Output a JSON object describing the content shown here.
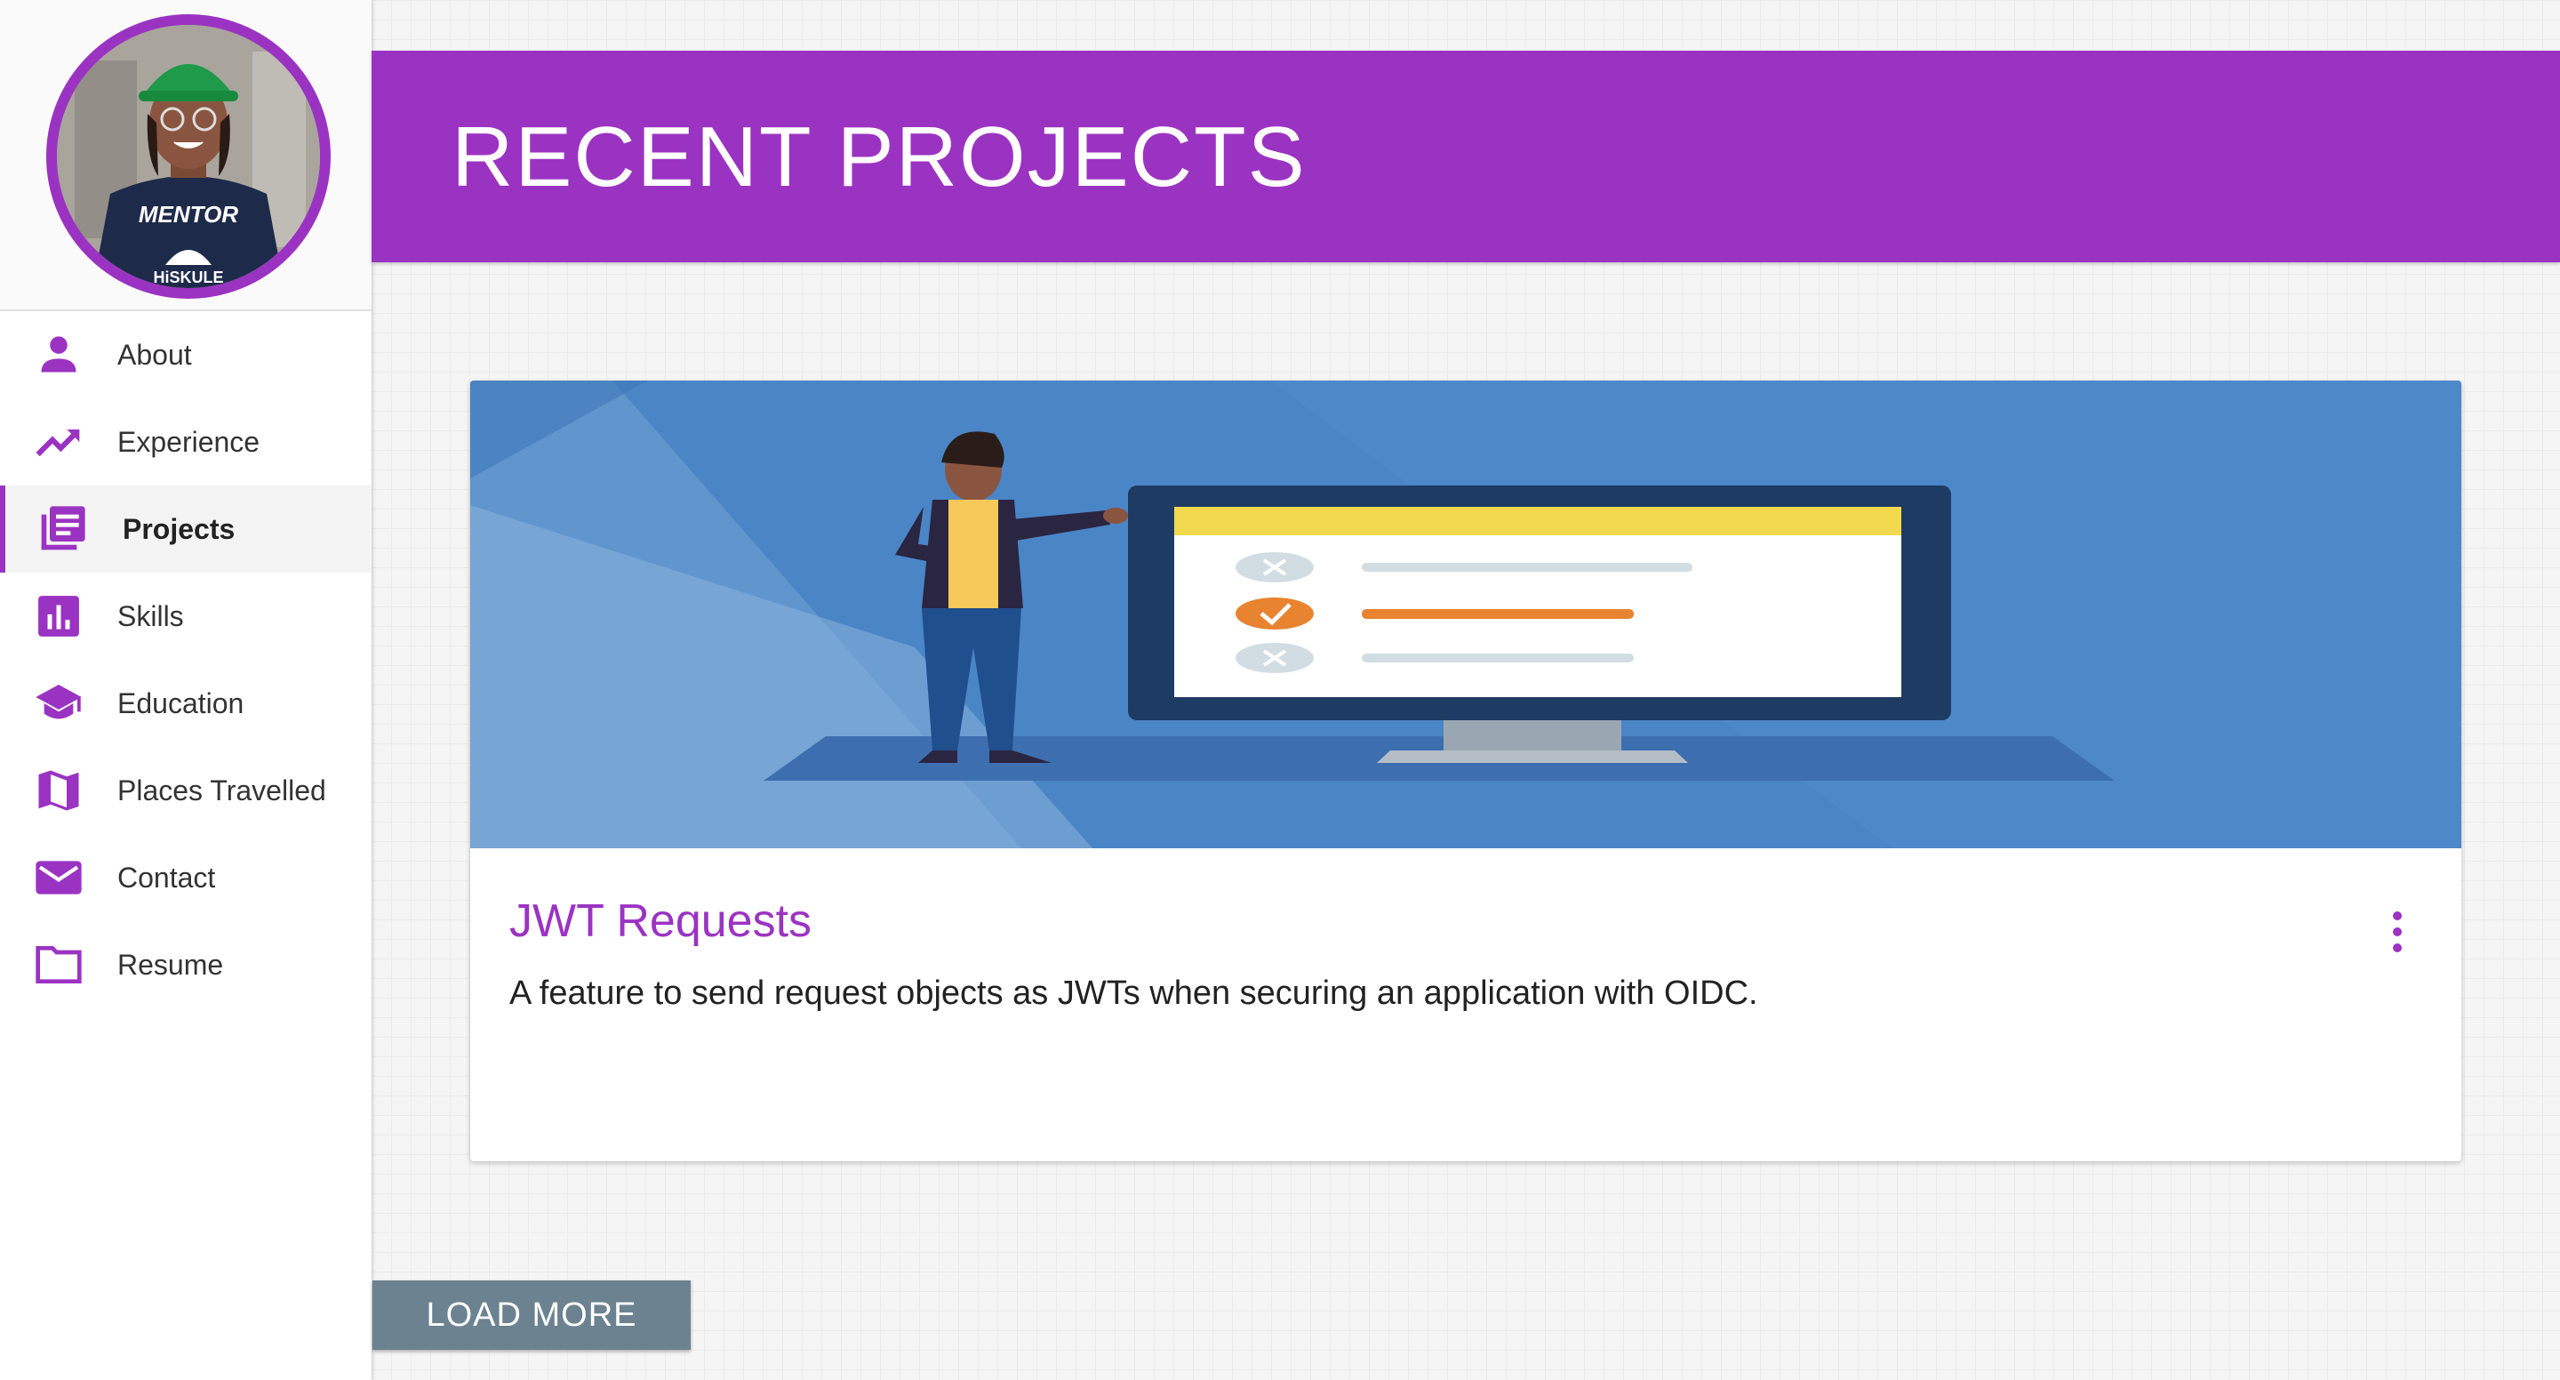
{
  "sidebar": {
    "avatar_alt": "profile-photo",
    "shirt_text": "MENTOR",
    "shirt_logo_text": "HiSKULE",
    "items": [
      {
        "label": "About",
        "icon": "person-icon",
        "active": false
      },
      {
        "label": "Experience",
        "icon": "trending-up-icon",
        "active": false
      },
      {
        "label": "Projects",
        "icon": "list-document-icon",
        "active": true
      },
      {
        "label": "Skills",
        "icon": "bar-chart-icon",
        "active": false
      },
      {
        "label": "Education",
        "icon": "graduation-cap-icon",
        "active": false
      },
      {
        "label": "Places Travelled",
        "icon": "map-icon",
        "active": false
      },
      {
        "label": "Contact",
        "icon": "mail-icon",
        "active": false
      },
      {
        "label": "Resume",
        "icon": "folder-icon",
        "active": false
      }
    ]
  },
  "header": {
    "title": "RECENT PROJECTS"
  },
  "card": {
    "title": "JWT Requests",
    "description": "A feature to send request objects as JWTs when securing an application with OIDC.",
    "menu_icon": "more-vert-icon"
  },
  "actions": {
    "load_more": "LOAD MORE"
  },
  "colors": {
    "accent": "#9b33c2",
    "button": "#6c8290",
    "media_bg": "#4a85c6"
  }
}
